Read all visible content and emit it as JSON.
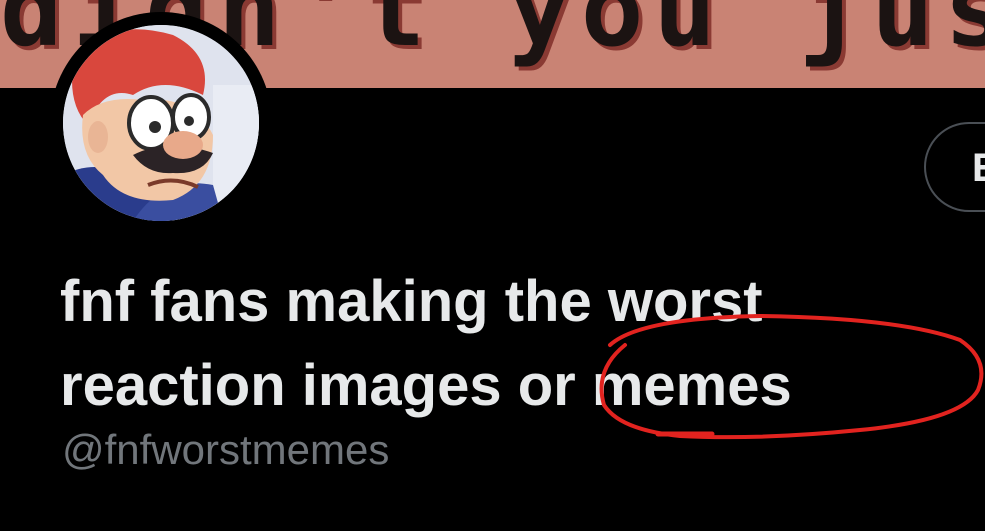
{
  "banner": {
    "text": "didn't you just"
  },
  "profile": {
    "display_name_line1": "fnf fans making the worst",
    "display_name_line2": "reaction images or memes",
    "handle": "@fnfworstmemes"
  },
  "actions": {
    "edit_label": "E"
  },
  "annotation": {
    "color": "#e2231f"
  },
  "colors": {
    "background": "#000000",
    "banner": "#c98374",
    "name_text": "#e7e9ea",
    "handle_text": "#71767b"
  }
}
